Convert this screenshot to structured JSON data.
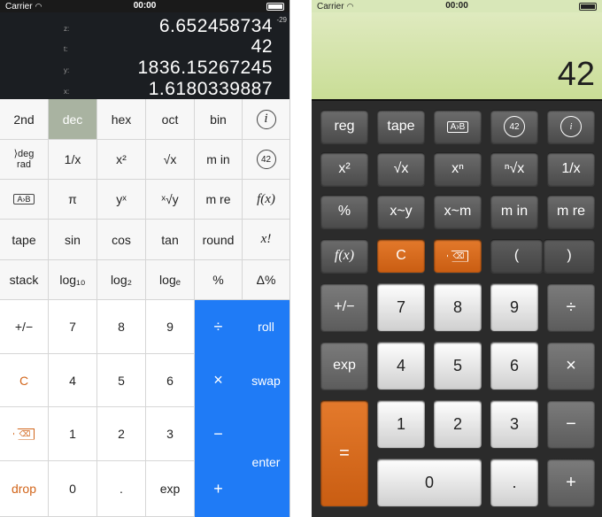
{
  "left_screen": {
    "status": {
      "carrier": "Carrier",
      "time": "00:00"
    },
    "display": {
      "exponent": "-29",
      "stack": [
        {
          "reg": "z:",
          "value": "6.652458734"
        },
        {
          "reg": "t:",
          "value": "42"
        },
        {
          "reg": "y:",
          "value": "1836.15267245"
        },
        {
          "reg": "x:",
          "value": "1.6180339887"
        }
      ]
    },
    "keys": {
      "r1": [
        "2nd",
        "dec",
        "hex",
        "oct",
        "bin",
        "i"
      ],
      "r2": [
        "⟩deg\nrad",
        "1/x",
        "x²",
        "√x",
        "m in",
        "42"
      ],
      "r3": [
        "A›B",
        "π",
        "yˣ",
        "ˣ√y",
        "m re",
        "f(x)"
      ],
      "r4": [
        "tape",
        "sin",
        "cos",
        "tan",
        "round",
        "x!"
      ],
      "r5": [
        "stack",
        "log₁₀",
        "log₂",
        "logₑ",
        "%",
        "Δ%"
      ],
      "r6": [
        "+/−",
        "7",
        "8",
        "9",
        "÷",
        "roll"
      ],
      "r7": [
        "C",
        "4",
        "5",
        "6",
        "×",
        "swap"
      ],
      "r8": [
        "⌫",
        "1",
        "2",
        "3",
        "−",
        "enter"
      ],
      "r9": [
        "drop",
        "0",
        ".",
        "exp",
        "+"
      ]
    }
  },
  "right_screen": {
    "status": {
      "carrier": "Carrier",
      "time": "00:00"
    },
    "display": {
      "value": "42"
    },
    "keys": {
      "r1": [
        "reg",
        "tape",
        "A›B",
        "42",
        "i"
      ],
      "r2": [
        "x²",
        "√x",
        "xⁿ",
        "ⁿ√x",
        "1/x"
      ],
      "r3": [
        "%",
        "x~y",
        "x~m",
        "m in",
        "m re"
      ],
      "r4": [
        "f(x)",
        "C",
        "⌫",
        "(",
        ")"
      ],
      "r5": [
        "+/−",
        "7",
        "8",
        "9",
        "÷"
      ],
      "r6": [
        "exp",
        "4",
        "5",
        "6",
        "×"
      ],
      "r7": [
        "=",
        "1",
        "2",
        "3",
        "−"
      ],
      "r8": [
        "0",
        ".",
        "+"
      ]
    }
  },
  "colors": {
    "accent_blue": "#1f7bf6",
    "accent_orange": "#d2651a",
    "lcd_green": "#c9dd96"
  }
}
